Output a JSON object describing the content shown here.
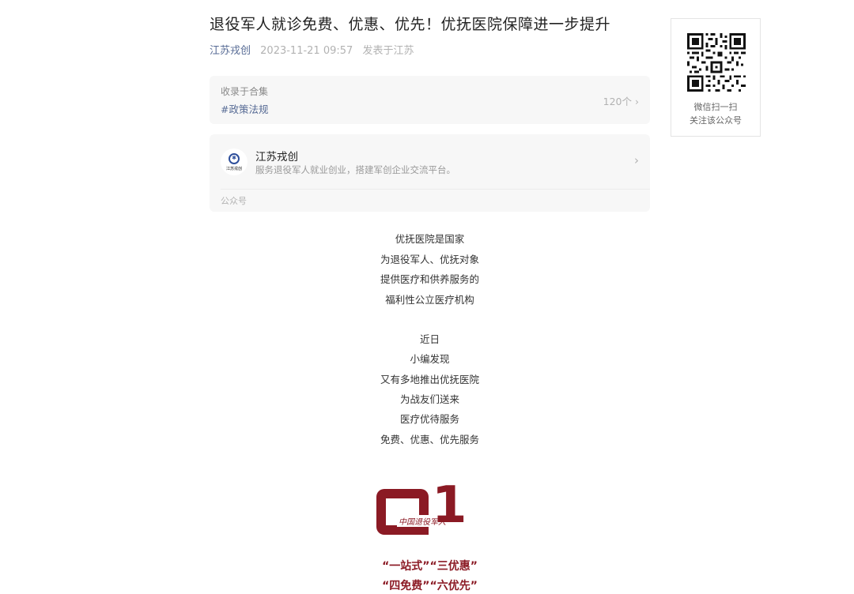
{
  "article": {
    "title": "退役军人就诊免费、优惠、优先！优抚医院保障进一步提升",
    "author": "江苏戎创",
    "time": "2023-11-21 09:57",
    "location": "发表于江苏"
  },
  "collection": {
    "label": "收录于合集",
    "tag": "#政策法规",
    "count": "120个 ›"
  },
  "account": {
    "name": "江苏戎创",
    "description": "服务退役军人就业创业，搭建军创企业交流平台。",
    "type": "公众号",
    "avatar_text": "江苏戎创",
    "arrow": "›"
  },
  "paragraphs": [
    [
      "优抚医院是国家",
      "为退役军人、优抚对象",
      "提供医疗和供养服务的",
      "福利性公立医疗机构"
    ],
    [
      "近日",
      "小编发现",
      "又有多地推出优抚医院",
      "为战友们送来",
      "医疗优待服务",
      "免费、优惠、优先服务"
    ]
  ],
  "section": {
    "number": "1",
    "badge_text": "中国退役军人"
  },
  "slogans": [
    "“一站式”“三优惠”",
    "“四免费”“六优先”"
  ],
  "qr": {
    "line1": "微信扫一扫",
    "line2": "关注该公众号"
  },
  "colors": {
    "link": "#576b95",
    "accent": "#8b1a24",
    "card_bg": "#f7f7f7"
  }
}
